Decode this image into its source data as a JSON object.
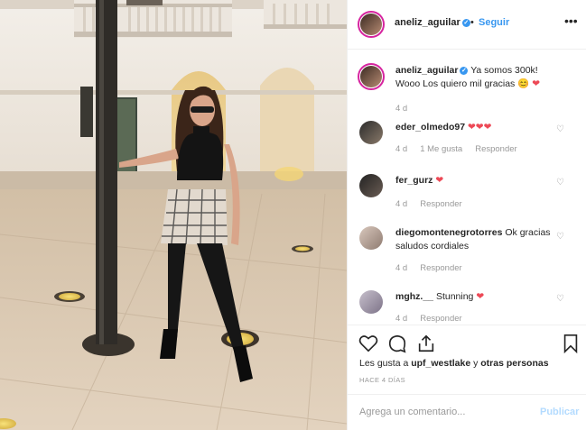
{
  "header": {
    "username": "aneliz_aguilar",
    "separator": "•",
    "follow_label": "Seguir",
    "more_icon": "ellipsis-icon"
  },
  "caption": {
    "username": "aneliz_aguilar",
    "text": "Ya somos 300k! Wooo Los quiero mil gracias 😊",
    "time": "4 d"
  },
  "comments": [
    {
      "username": "eder_olmedo97",
      "text": "",
      "time": "4 d",
      "likes": "1 Me gusta",
      "reply": "Responder",
      "hearts": 3
    },
    {
      "username": "fer_gurz",
      "text": "",
      "time": "4 d",
      "likes": "",
      "reply": "Responder",
      "hearts": 1
    },
    {
      "username": "diegomontenegrotorres",
      "text": "Ok gracias saludos cordiales",
      "time": "4 d",
      "likes": "",
      "reply": "Responder",
      "hearts": 0
    },
    {
      "username": "mghz.__",
      "text": "Stunning",
      "time": "4 d",
      "likes": "",
      "reply": "Responder",
      "hearts": 1
    }
  ],
  "actions": {
    "liked_by_prefix": "Les gusta a",
    "liked_by_user": "upf_westlake",
    "liked_by_suffix": "y",
    "liked_by_others": "otras personas",
    "posted_ago": "HACE 4 DÍAS"
  },
  "add_comment": {
    "placeholder": "Agrega un comentario...",
    "publish_label": "Publicar"
  },
  "colors": {
    "accent": "#3897f0",
    "heart": "#ed4956",
    "muted": "#999999"
  }
}
